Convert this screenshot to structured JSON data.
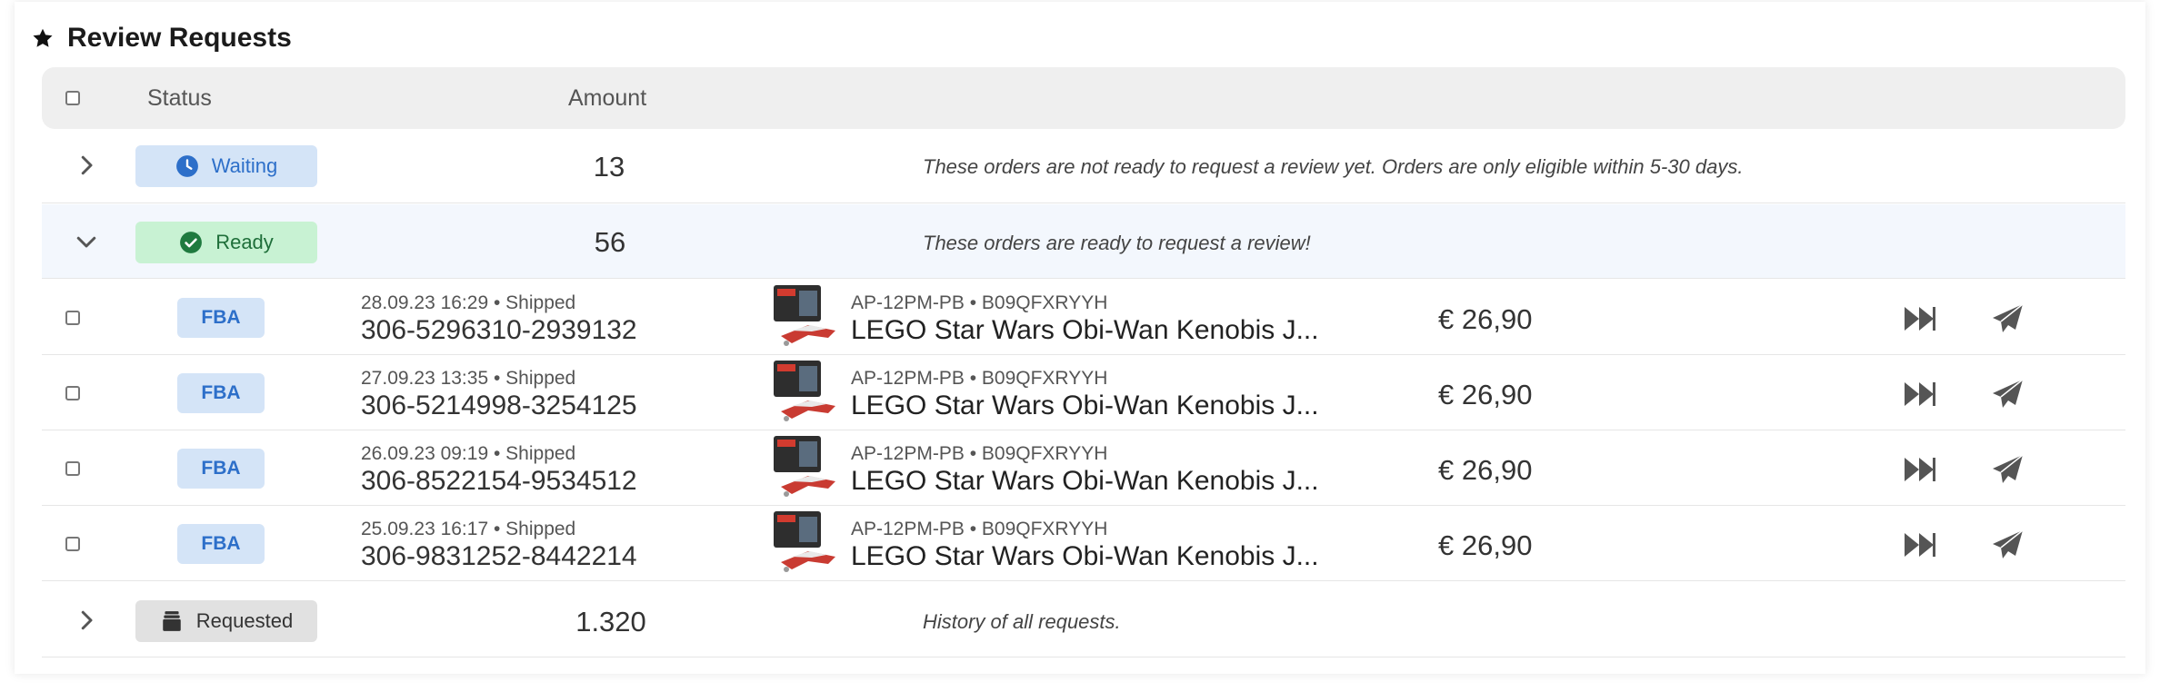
{
  "title": "Review Requests",
  "icons": {
    "title": "star-icon"
  },
  "colors": {
    "waiting_bg": "#d4e4f7",
    "waiting_text": "#2d6fc9",
    "ready_bg": "#c8f2d3",
    "ready_text": "#1f6f3a",
    "requested_bg": "#e1e1e1",
    "requested_text": "#333333",
    "fba_bg": "#d4e4f7",
    "fba_text": "#2d6fc9"
  },
  "header": {
    "status": "Status",
    "amount": "Amount"
  },
  "groups": [
    {
      "status": "Waiting",
      "amount": "13",
      "note": "These orders are not ready to request a review yet. Orders are only eligible within 5-30 days.",
      "expanded": false,
      "icon": "clock-icon"
    },
    {
      "status": "Ready",
      "amount": "56",
      "note": "These orders are ready to request a review!",
      "expanded": true,
      "icon": "check-circle-icon"
    },
    {
      "status": "Requested",
      "amount": "1.320",
      "note": "History of all requests.",
      "expanded": false,
      "icon": "archive-icon"
    }
  ],
  "orders": [
    {
      "channel": "FBA",
      "date": "28.09.23 16:29",
      "state": "• Shipped",
      "order_id": "306-5296310-2939132",
      "sku": "AP-12PM-PB  •  B09QFXRYYH",
      "product": "LEGO Star Wars Obi-Wan Kenobis J...",
      "price": "€ 26,90"
    },
    {
      "channel": "FBA",
      "date": "27.09.23 13:35",
      "state": "• Shipped",
      "order_id": "306-5214998-3254125",
      "sku": "AP-12PM-PB  •  B09QFXRYYH",
      "product": "LEGO Star Wars Obi-Wan Kenobis J...",
      "price": "€ 26,90"
    },
    {
      "channel": "FBA",
      "date": "26.09.23 09:19",
      "state": "• Shipped",
      "order_id": "306-8522154-9534512",
      "sku": "AP-12PM-PB  •  B09QFXRYYH",
      "product": "LEGO Star Wars Obi-Wan Kenobis J...",
      "price": "€ 26,90"
    },
    {
      "channel": "FBA",
      "date": "25.09.23 16:17",
      "state": "• Shipped",
      "order_id": "306-9831252-8442214",
      "sku": "AP-12PM-PB  •  B09QFXRYYH",
      "product": "LEGO Star Wars Obi-Wan Kenobis J...",
      "price": "€ 26,90"
    }
  ]
}
